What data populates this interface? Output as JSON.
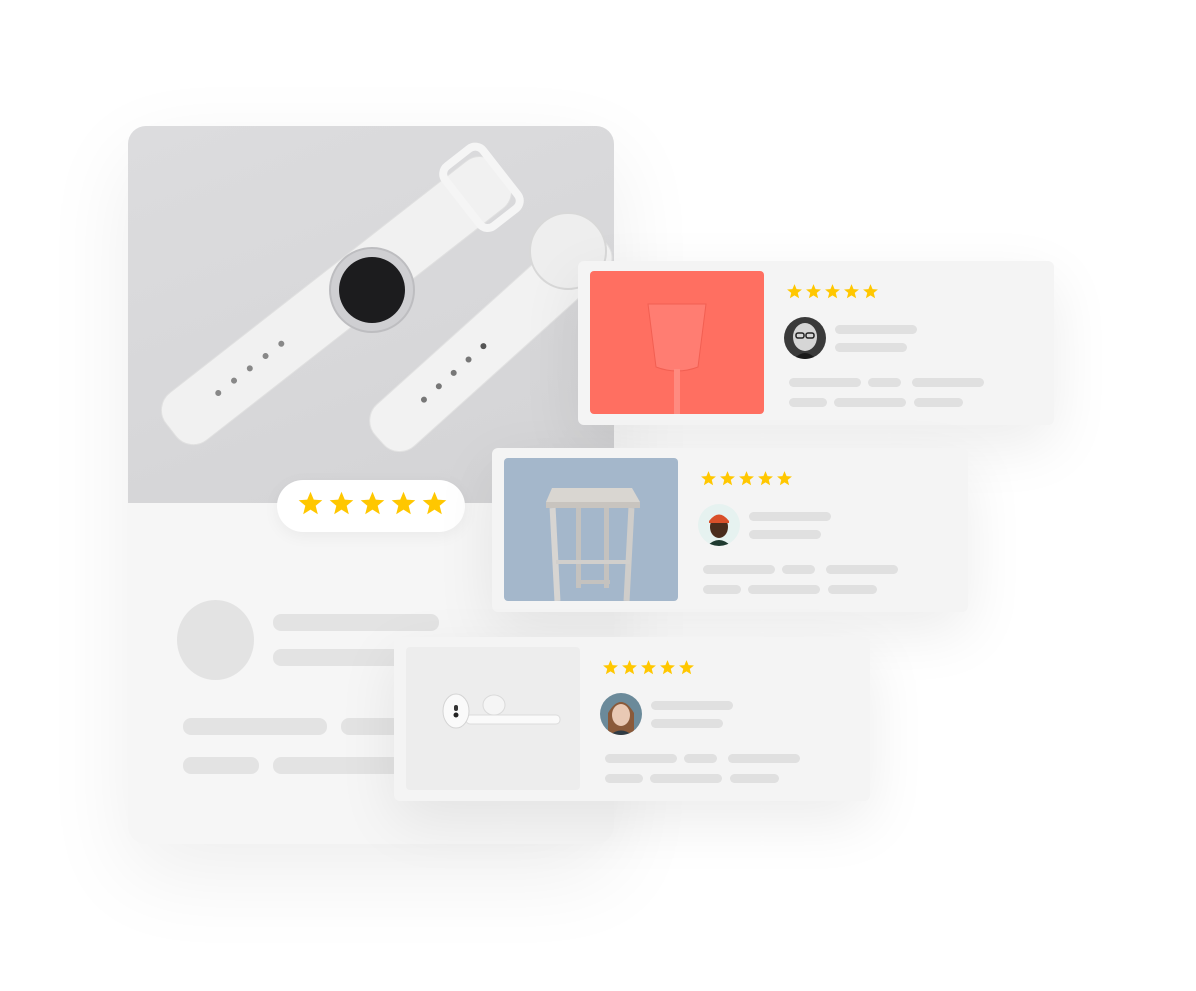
{
  "main_product": {
    "image": "smartwatch-pair-photo",
    "rating_stars": 5
  },
  "reviews": [
    {
      "product_image": "coral-cup-photo",
      "rating_stars": 5,
      "avatar": "bald-man-glasses-avatar"
    },
    {
      "product_image": "wooden-stool-photo",
      "rating_stars": 5,
      "avatar": "man-orange-beanie-avatar"
    },
    {
      "product_image": "earbuds-photo",
      "rating_stars": 5,
      "avatar": "woman-portrait-avatar"
    }
  ],
  "colors": {
    "star": "#FFC700",
    "skeleton": "#E3E3E3",
    "card_background": "#F4F4F4",
    "coral_product": "#FF6F61",
    "stool_background": "#A4B7CB"
  }
}
